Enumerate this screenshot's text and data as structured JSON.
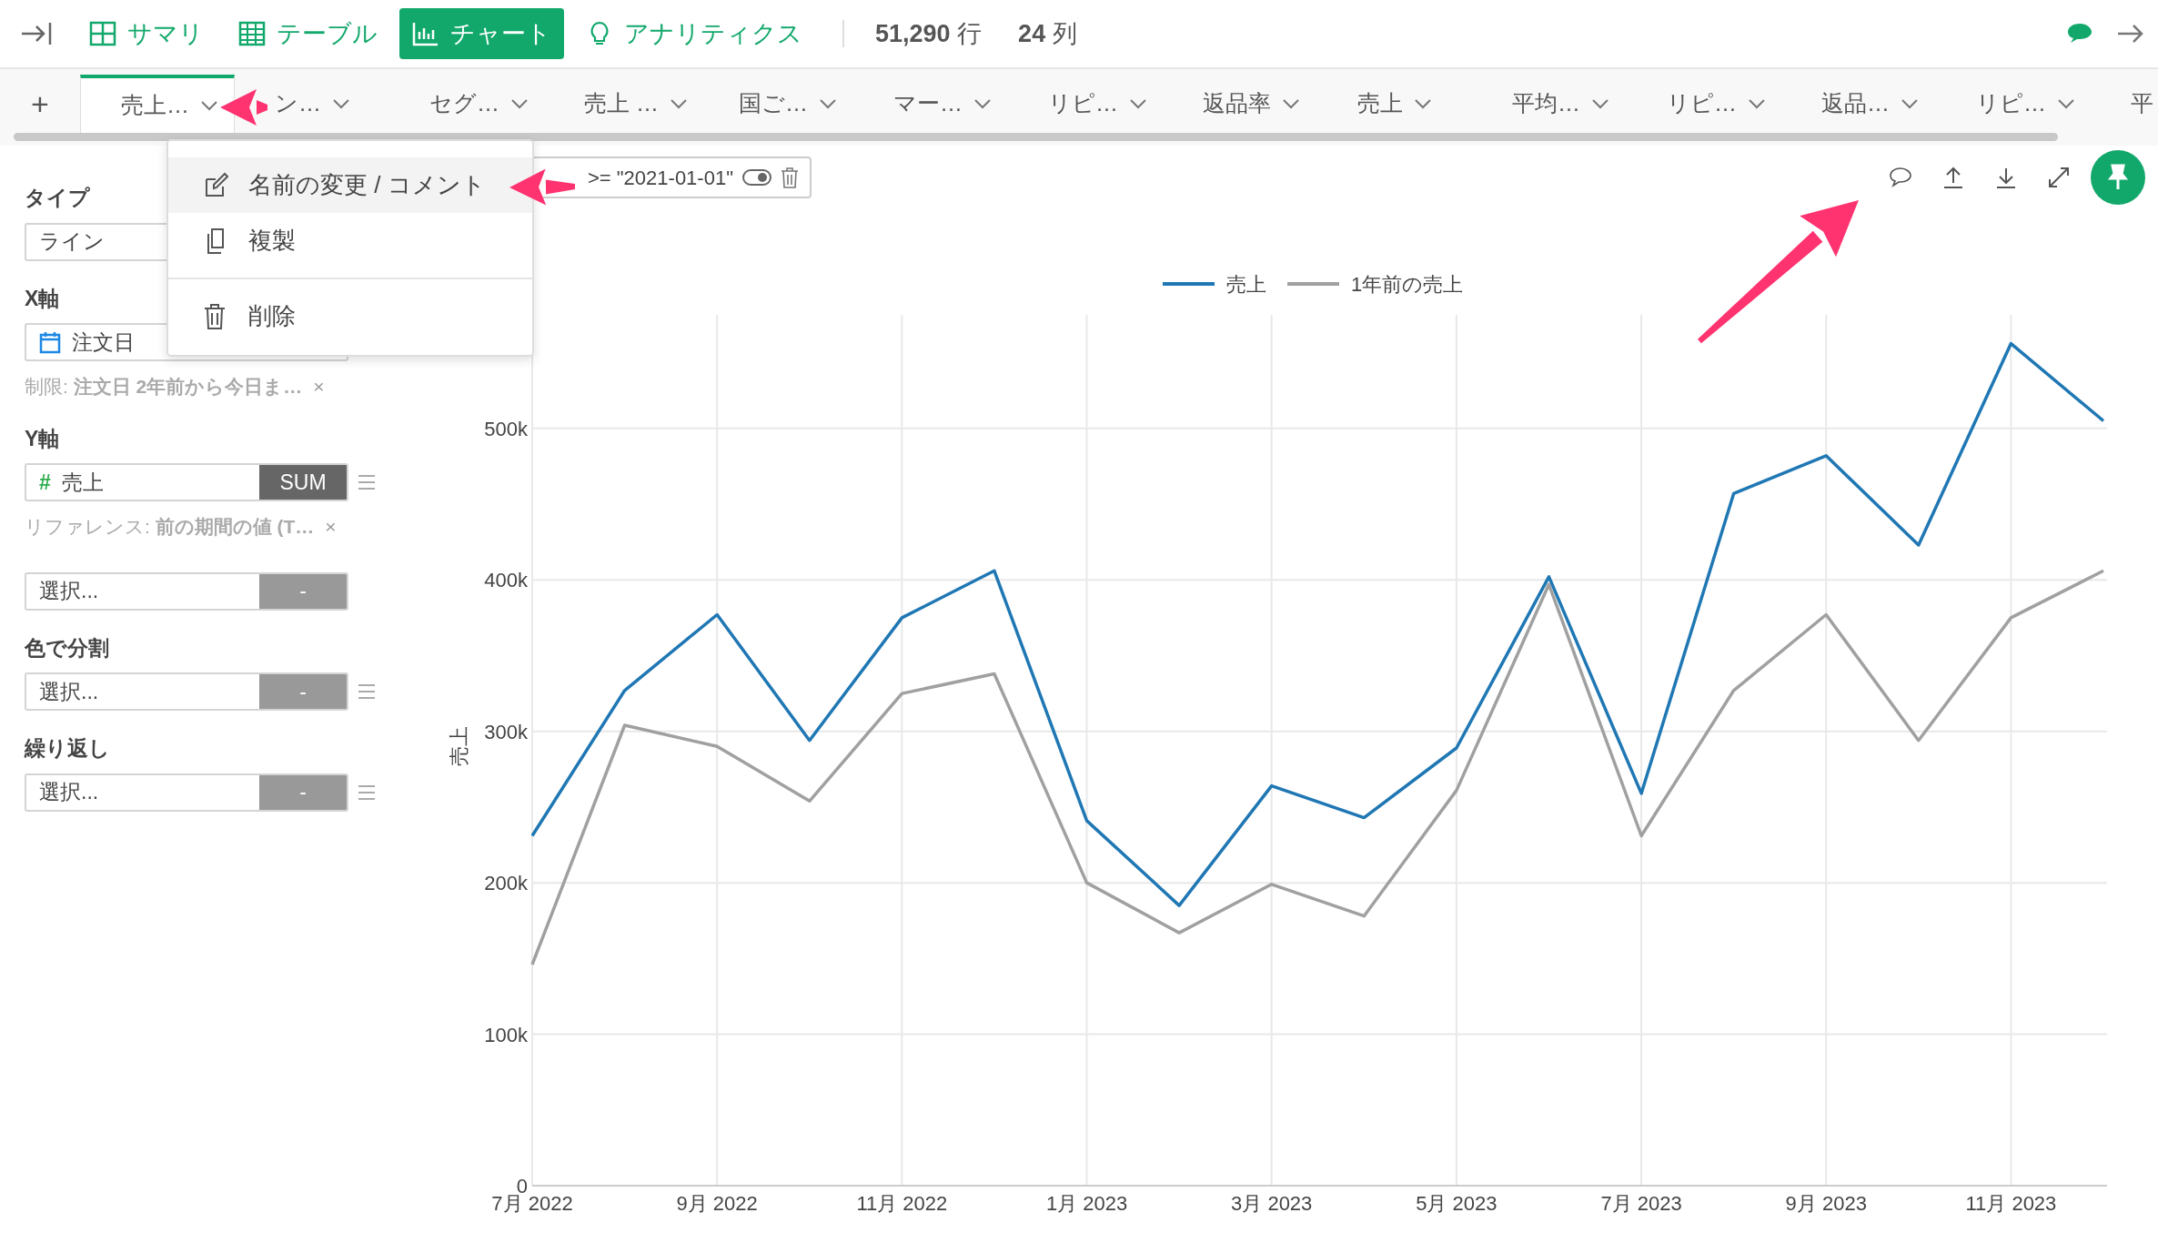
{
  "topbar": {
    "items": [
      {
        "label": "サマリ",
        "selected": false
      },
      {
        "label": "テーブル",
        "selected": false
      },
      {
        "label": "チャート",
        "selected": true
      },
      {
        "label": "アナリティクス",
        "selected": false
      }
    ],
    "counts": [
      "**51,290** 行",
      "**24** 列"
    ]
  },
  "add_tab": "+",
  "tabs": [
    {
      "label": "売上…",
      "selected": true
    },
    {
      "label": "ン…",
      "selected": false
    },
    {
      "label": "セグ…",
      "selected": false
    },
    {
      "label": "売上 …",
      "selected": false
    },
    {
      "label": "国ご…",
      "selected": false
    },
    {
      "label": "マー…",
      "selected": false
    },
    {
      "label": "リピ…",
      "selected": false
    },
    {
      "label": "返品率",
      "selected": false
    },
    {
      "label": "売上",
      "selected": false
    },
    {
      "label": "平均…",
      "selected": false
    },
    {
      "label": "リピ…",
      "selected": false
    },
    {
      "label": "返品…",
      "selected": false
    },
    {
      "label": "リピ…",
      "selected": false
    },
    {
      "label": "平",
      "selected": false
    }
  ],
  "menu": {
    "groups": [
      [
        {
          "label": "名前の変更 / コメント",
          "selected": true
        },
        {
          "label": "複製",
          "selected": false
        }
      ],
      [
        {
          "label": "削除",
          "selected": false
        }
      ]
    ]
  },
  "sidebar": {
    "sections": [
      {
        "label": "タイプ",
        "fields": [
          {
            "kind": "select",
            "value": "ライン",
            "handle": false
          }
        ]
      },
      {
        "label": "X軸",
        "fields": [
          {
            "kind": "date",
            "value": "注文日",
            "handle": false,
            "note": "制限: **注文日 2年前から今日ま…**",
            "note_close": "×"
          }
        ]
      },
      {
        "label": "Y軸",
        "fields": [
          {
            "kind": "number",
            "prefix": "#",
            "value": "売上",
            "agg": "SUM",
            "handle": true,
            "note": "リファレンス: **前の期間の値 (T…**",
            "note_close": "×"
          },
          {
            "kind": "empty",
            "value": "選択...",
            "agg": "-",
            "handle": false
          }
        ]
      },
      {
        "label": "色で分割",
        "fields": [
          {
            "kind": "empty",
            "value": "選択...",
            "agg": "-",
            "handle": true
          }
        ]
      },
      {
        "label": "繰り返し",
        "fields": [
          {
            "kind": "empty",
            "value": "選択...",
            "agg": "-",
            "handle": true
          }
        ]
      }
    ]
  },
  "filter": {
    "text": ">=  \"2021-01-01\""
  },
  "chart": {
    "chart_data": {
      "type": "line",
      "ylabel": "売上",
      "categories": [
        "7月 2022",
        null,
        "9月 2022",
        null,
        "11月 2022",
        null,
        "1月 2023",
        null,
        "3月 2023",
        null,
        "5月 2023",
        null,
        "7月 2023",
        null,
        "9月 2023",
        null,
        "11月 2023",
        null
      ],
      "grid": true,
      "legend": true,
      "series": [
        {
          "name": "売上",
          "color": "#1f77b4",
          "values": [
            231000,
            327000,
            377000,
            294000,
            375000,
            406000,
            241000,
            185000,
            264000,
            243000,
            289000,
            402000,
            259000,
            457000,
            482000,
            423000,
            556000,
            505000
          ]
        },
        {
          "name": "1年前の売上",
          "color": "#a0a0a0",
          "values": [
            146000,
            304000,
            290000,
            254000,
            325000,
            338000,
            200000,
            167000,
            199000,
            178000,
            261000,
            397000,
            231000,
            327000,
            377000,
            294000,
            375000,
            406000
          ]
        }
      ],
      "ylim": [
        0,
        575000
      ],
      "yticks": [
        {
          "value": 0,
          "label": "0"
        },
        {
          "value": 100000,
          "label": "100k"
        },
        {
          "value": 200000,
          "label": "200k"
        },
        {
          "value": 300000,
          "label": "300k"
        },
        {
          "value": 400000,
          "label": "400k"
        },
        {
          "value": 500000,
          "label": "500k"
        }
      ]
    }
  }
}
